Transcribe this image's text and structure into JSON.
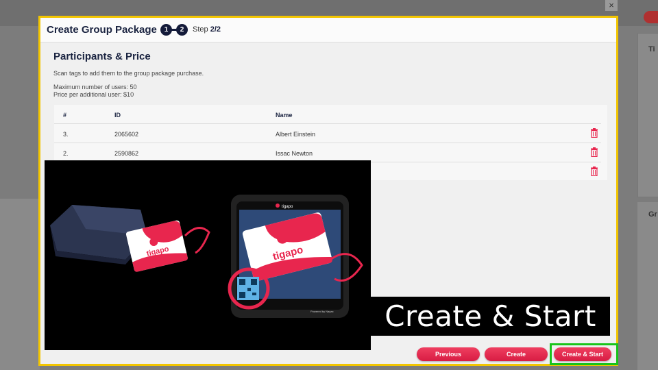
{
  "dialog": {
    "title": "Create Group Package",
    "steps": [
      "1",
      "2"
    ],
    "step_label": "Step",
    "step_value": "2/2",
    "close_glyph": "×"
  },
  "section": {
    "title": "Participants & Price",
    "description": "Scan tags to add them to the group package purchase.",
    "max_users": "Maximum number of users: 50",
    "price": "Price per additional user: $10"
  },
  "table": {
    "headers": [
      "#",
      "ID",
      "Name"
    ],
    "rows": [
      {
        "num": "3.",
        "id": "2065602",
        "name": "Albert Einstein"
      },
      {
        "num": "2.",
        "id": "2590862",
        "name": "Issac Newton"
      }
    ]
  },
  "buttons": {
    "previous": "Previous",
    "create": "Create",
    "create_start": "Create & Start"
  },
  "overlay": {
    "caption": "Create & Start",
    "card_brand": "tigapo",
    "device_brand": "tigapo",
    "device_footer": "Powered by Nayax"
  },
  "colors": {
    "accent": "#e8264e",
    "navy": "#141b3a",
    "highlight_border": "#f2c500",
    "focus_border": "#18c41a"
  }
}
